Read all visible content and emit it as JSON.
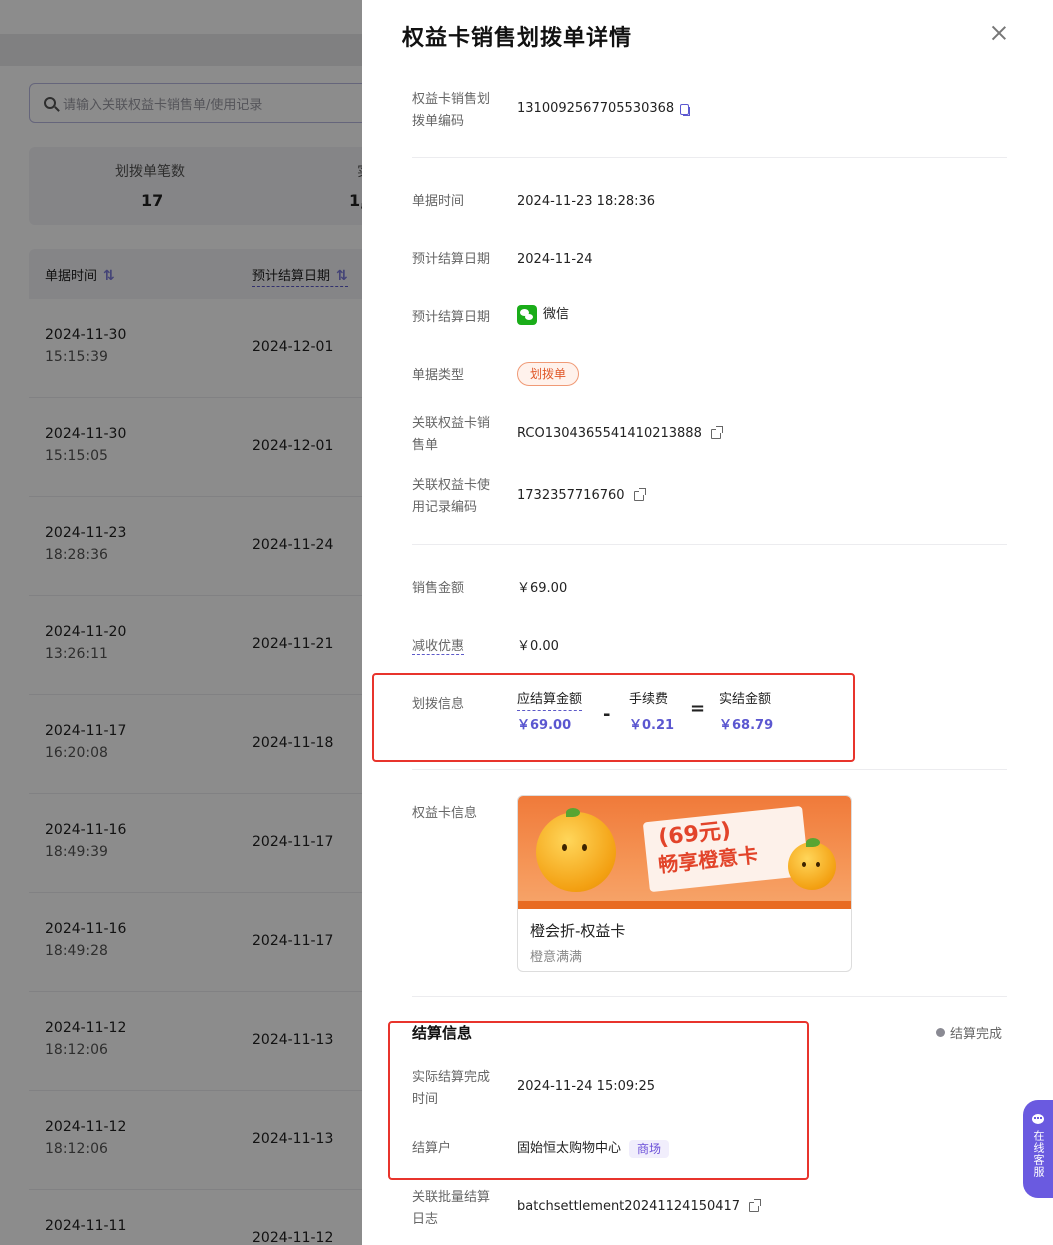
{
  "background": {
    "search_placeholder": "请输入关联权益卡销售单/使用记录",
    "stat_label": "划拨单笔数",
    "stat_value": "17",
    "stat_label_cut": "实",
    "stat_value_cut": "1,",
    "table_headers": [
      "单据时间",
      "预计结算日期"
    ],
    "sort_glyph": "⇅",
    "rows": [
      {
        "date": "2024-11-30",
        "time": "15:15:39",
        "settle": "2024-12-01"
      },
      {
        "date": "2024-11-30",
        "time": "15:15:05",
        "settle": "2024-12-01"
      },
      {
        "date": "2024-11-23",
        "time": "18:28:36",
        "settle": "2024-11-24"
      },
      {
        "date": "2024-11-20",
        "time": "13:26:11",
        "settle": "2024-11-21"
      },
      {
        "date": "2024-11-17",
        "time": "16:20:08",
        "settle": "2024-11-18"
      },
      {
        "date": "2024-11-16",
        "time": "18:49:39",
        "settle": "2024-11-17"
      },
      {
        "date": "2024-11-16",
        "time": "18:49:28",
        "settle": "2024-11-17"
      },
      {
        "date": "2024-11-12",
        "time": "18:12:06",
        "settle": "2024-11-13"
      },
      {
        "date": "2024-11-12",
        "time": "18:12:06",
        "settle": "2024-11-13"
      },
      {
        "date": "2024-11-11",
        "time": "",
        "settle": "2024-11-12"
      }
    ]
  },
  "drawer": {
    "title": "权益卡销售划拨单详情",
    "fields": {
      "code_label": "权益卡销售划拨单编码",
      "code_value": "1310092567705530368",
      "doc_time_label": "单据时间",
      "doc_time_value": "2024-11-23 18:28:36",
      "settle_date_label": "预计结算日期",
      "settle_date_value": "2024-11-24",
      "channel_label": "预计结算日期",
      "channel_value": "微信",
      "doc_type_label": "单据类型",
      "doc_type_value": "划拨单",
      "sale_order_label": "关联权益卡销售单",
      "sale_order_value": "RCO1304365541410213888",
      "usage_label": "关联权益卡使用记录编码",
      "usage_value": "1732357716760",
      "sale_amount_label": "销售金额",
      "sale_amount_value": "￥69.00",
      "discount_label": "减收优惠",
      "discount_value": "￥0.00",
      "transfer_label": "划拨信息",
      "card_info_label": "权益卡信息"
    },
    "transfer": {
      "payable_label": "应结算金额",
      "payable_value": "￥69.00",
      "minus": "-",
      "fee_label": "手续费",
      "fee_value": "￥0.21",
      "equals": "=",
      "actual_label": "实结金额",
      "actual_value": "￥68.79"
    },
    "card": {
      "banner_line1": "(69元)",
      "banner_line2": "畅享橙意卡",
      "name": "橙会折-权益卡",
      "subtitle": "橙意满满"
    },
    "settlement": {
      "section_title": "结算信息",
      "status": "结算完成",
      "complete_time_label": "实际结算完成时间",
      "complete_time_value": "2024-11-24 15:09:25",
      "account_label": "结算户",
      "account_value": "固始恒太购物中心",
      "account_tag": "商场",
      "batch_label": "关联批量结算日志",
      "batch_value": "batchsettlement20241124150417"
    },
    "float_service": "在线客服"
  },
  "colors": {
    "accent": "#5b57d0",
    "highlight_border": "#e8342c",
    "tag_orange": "#e0582a",
    "wechat_green": "#1aad19"
  }
}
